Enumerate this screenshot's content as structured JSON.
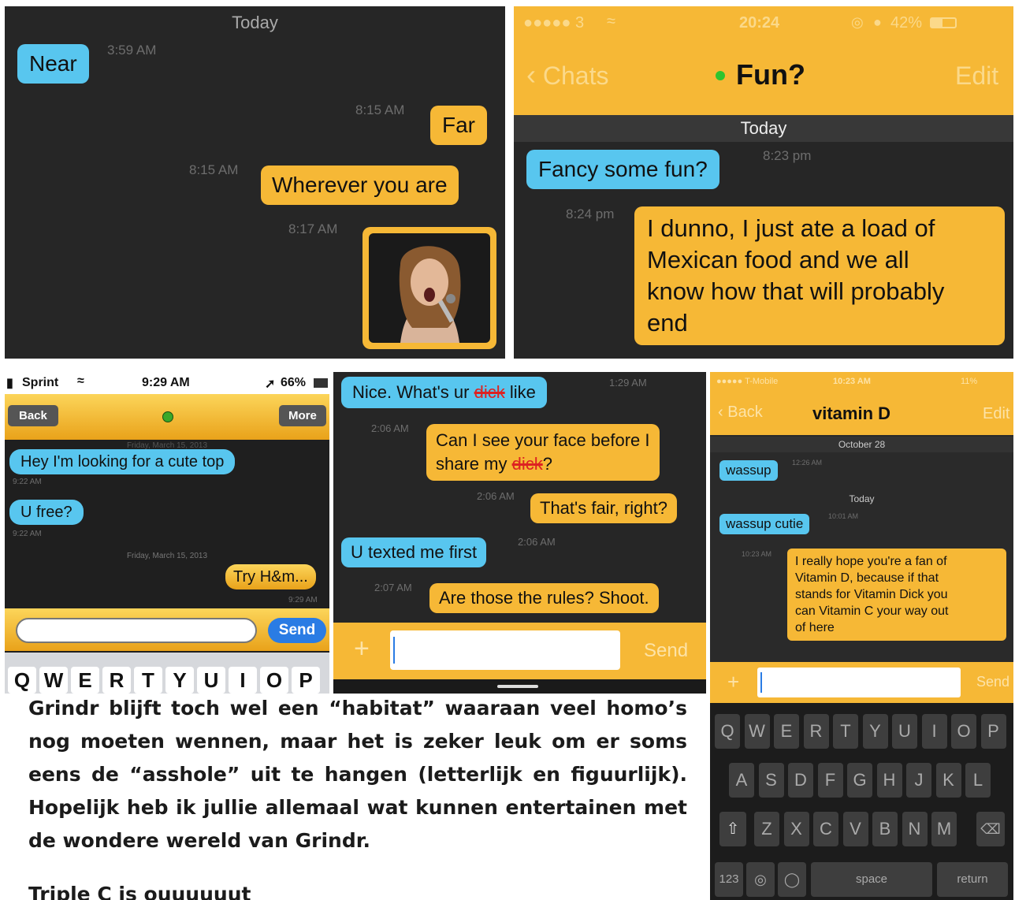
{
  "p1": {
    "date": "Today",
    "messages": [
      {
        "text": "Near",
        "time": "3:59 AM"
      },
      {
        "text": "Far",
        "time": "8:15 AM"
      },
      {
        "text": "Wherever you are",
        "time": "8:15 AM"
      },
      {
        "text": "",
        "time": "8:17 AM"
      }
    ]
  },
  "p2": {
    "status": {
      "carrier": "●●●●● 3",
      "time": "20:24",
      "battery": "42%"
    },
    "back": "Chats",
    "title": "Fun?",
    "edit": "Edit",
    "date": "Today",
    "messages": [
      {
        "text": "Fancy some fun?",
        "time": "8:23 pm"
      },
      {
        "lines": [
          "I dunno, I just ate a load of",
          "Mexican food and we all",
          "know how that will probably",
          "end"
        ],
        "time": "8:24 pm"
      }
    ]
  },
  "p3": {
    "status": {
      "carrier": "Sprint",
      "time": "9:29 AM",
      "battery": "66%"
    },
    "back": "Back",
    "more": "More",
    "date_top": "Friday, March 15, 2013",
    "date_mid": "Friday, March 15, 2013",
    "messages": [
      {
        "text": "Hey I'm looking for a cute top",
        "time": "9:22 AM"
      },
      {
        "text": "U free?",
        "time": "9:22 AM"
      },
      {
        "text": "Try H&m...",
        "time": "9:29 AM"
      }
    ],
    "send": "Send",
    "keys": [
      "Q",
      "W",
      "E",
      "R",
      "T",
      "Y",
      "U",
      "I",
      "O",
      "P"
    ]
  },
  "p4": {
    "messages": [
      {
        "text_before": "Nice. What's ur ",
        "text_redacted": "dick",
        "text_after": " like",
        "time": "1:29 AM"
      },
      {
        "line1": "Can I see your face before I",
        "line2_before": "share my ",
        "line2_redacted": "dick",
        "line2_after": "?",
        "time": "2:06 AM"
      },
      {
        "text": "That's fair, right?",
        "time": "2:06 AM"
      },
      {
        "text": "U texted me first",
        "time": "2:06 AM"
      },
      {
        "text": "Are those the rules? Shoot.",
        "time": "2:07 AM"
      }
    ],
    "plus": "+",
    "send": "Send"
  },
  "p5": {
    "status": {
      "carrier": "●●●●● T-Mobile",
      "time": "10:23 AM",
      "battery": "11%"
    },
    "back": "Back",
    "title": "vitamin D",
    "edit": "Edit",
    "date1": "October 28",
    "date2": "Today",
    "messages": [
      {
        "text": "wassup",
        "time": "12:26 AM"
      },
      {
        "text": "wassup cutie",
        "time": "10:01 AM"
      },
      {
        "lines": [
          "I really hope you're a fan of",
          "Vitamin D, because if that",
          "stands for Vitamin Dick you",
          "can Vitamin C your way out",
          "of here"
        ],
        "time": "10:23 AM"
      }
    ],
    "plus": "+",
    "send": "Send",
    "row1": [
      "Q",
      "W",
      "E",
      "R",
      "T",
      "Y",
      "U",
      "I",
      "O",
      "P"
    ],
    "row2": [
      "A",
      "S",
      "D",
      "F",
      "G",
      "H",
      "J",
      "K",
      "L"
    ],
    "row3": [
      "Z",
      "X",
      "C",
      "V",
      "B",
      "N",
      "M"
    ],
    "k123": "123",
    "space": "space",
    "return": "return"
  },
  "caption": "Grindr blijft toch wel een “habitat” waaraan veel homo’s nog moeten wennen, maar het is zeker leuk om er soms eens de “asshole” uit te hangen (letterlijk en figuurlijk). Hopelijk heb ik jullie allemaal wat kunnen entertainen met de wondere wereld van Grindr.",
  "caption2": "Triple C is ouuuuuut"
}
